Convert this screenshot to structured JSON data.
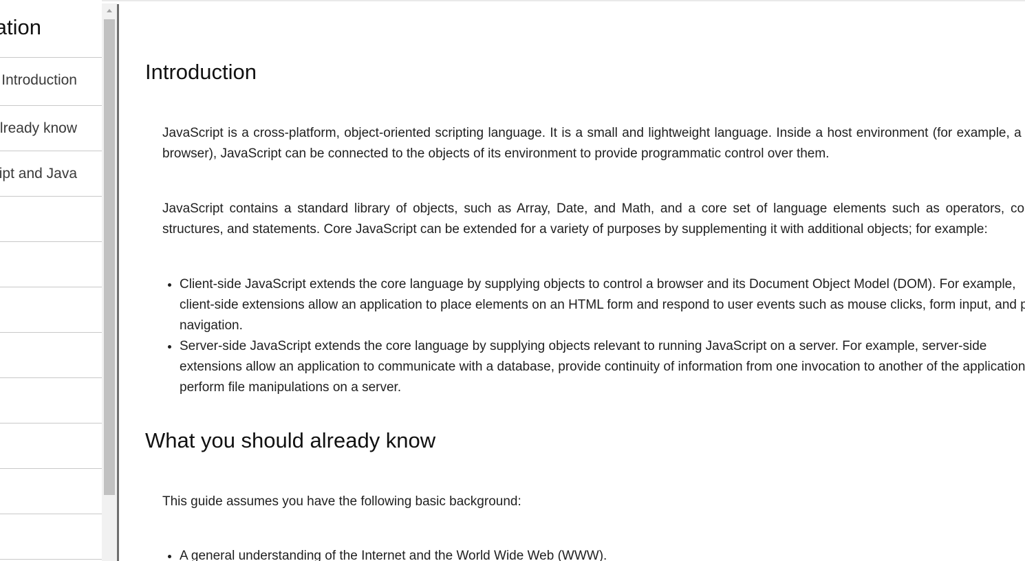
{
  "sidebar": {
    "title": "JavaScript Documentation",
    "items": [
      {
        "label": "Introduction"
      },
      {
        "label": "What you should already know"
      },
      {
        "label": "JavaScript and Java"
      },
      {
        "label": ""
      },
      {
        "label": ""
      },
      {
        "label": ""
      },
      {
        "label": ""
      },
      {
        "label": ""
      },
      {
        "label": ""
      },
      {
        "label": ""
      },
      {
        "label": ""
      }
    ]
  },
  "main": {
    "sections": [
      {
        "heading": "Introduction",
        "paragraphs": [
          "JavaScript is a cross-platform, object-oriented scripting language. It is a small and lightweight language. Inside a host environment (for example, a web browser), JavaScript can be connected to the objects of its environment to provide programmatic control over them.",
          "JavaScript contains a standard library of objects, such as Array, Date, and Math, and a core set of language elements such as operators, control structures, and statements. Core JavaScript can be extended for a variety of purposes by supplementing it with additional objects; for example:"
        ],
        "bullets": [
          "Client-side JavaScript extends the core language by supplying objects to control a browser and its Document Object Model (DOM). For example, client-side extensions allow an application to place elements on an HTML form and respond to user events such as mouse clicks, form input, and page navigation.",
          "Server-side JavaScript extends the core language by supplying objects relevant to running JavaScript on a server. For example, server-side extensions allow an application to communicate with a database, provide continuity of information from one invocation to another of the application, or perform file manipulations on a server."
        ]
      },
      {
        "heading": "What you should already know",
        "paragraphs": [
          "This guide assumes you have the following basic background:"
        ],
        "bullets": [
          "A general understanding of the Internet and the World Wide Web (WWW)."
        ]
      }
    ]
  },
  "scrollbar": {
    "thumb_fraction": 0.85
  },
  "colors": {
    "divider": "#6e6e6e",
    "scroll_thumb": "#c1c1c1",
    "scroll_track": "#f1f1f1",
    "row_border": "#c8c8c8"
  }
}
